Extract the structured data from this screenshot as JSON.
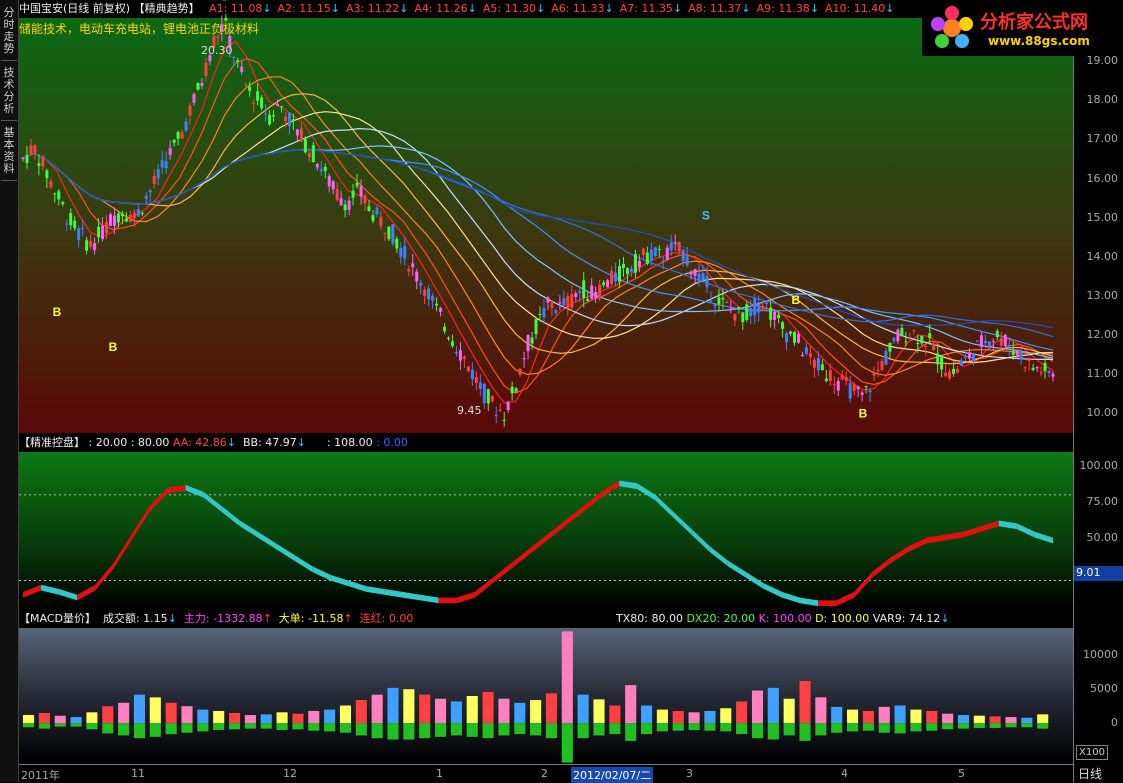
{
  "sidebar": {
    "tabs": [
      "分时走势",
      "技术分析",
      "基本资料"
    ]
  },
  "main": {
    "header": {
      "stock": "中国宝安(日线 前复权)",
      "indicator": "【精典趋势】",
      "subtitle": "储能技术，电动车充电站，锂电池正负极材料",
      "mas": [
        {
          "label": "A1: 11.08",
          "arrow": "↓"
        },
        {
          "label": "A2: 11.15",
          "arrow": "↓"
        },
        {
          "label": "A3: 11.22",
          "arrow": "↓"
        },
        {
          "label": "A4: 11.26",
          "arrow": "↓"
        },
        {
          "label": "A5: 11.30",
          "arrow": "↓"
        },
        {
          "label": "A6: 11.33",
          "arrow": "↓"
        },
        {
          "label": "A7: 11.35",
          "arrow": "↓"
        },
        {
          "label": "A8: 11.37",
          "arrow": "↓"
        },
        {
          "label": "A9: 11.38",
          "arrow": "↓"
        },
        {
          "label": "A10: 11.40",
          "arrow": "↓"
        }
      ]
    },
    "hi_label": "20.30",
    "lo_label": "9.45"
  },
  "ind": {
    "header": {
      "title": "【精准控盘】",
      "v1": ": 20.00",
      "v2": ": 80.00",
      "aa": "AA: 42.86",
      "aa_arrow": "↓",
      "bb": "BB: 47.97",
      "bb_arrow": "↓",
      "v3": ": 108.00",
      "v4": ": 0.00"
    },
    "side_value": "9.01"
  },
  "macd": {
    "header": {
      "title": "【MACD量价】",
      "cje": "成交额: 1.15",
      "cje_arrow": "↓",
      "zl": "主力: -1332.88",
      "zl_arrow": "↑",
      "dd": "大单: -11.58",
      "dd_arrow": "↑",
      "lh": "连红: 0.00",
      "tx": "TX80: 80.00",
      "dx": "DX20: 20.00",
      "k": "K: 100.00",
      "d": "D: 100.00",
      "var9": "VAR9: 74.12",
      "var9_arrow": "↓"
    },
    "unit": "X100"
  },
  "logo": {
    "text": "分析家公式网",
    "url": "www.88gs.com"
  },
  "xaxis": {
    "labels": [
      {
        "t": "2011年"
      },
      {
        "t": "11"
      },
      {
        "t": "12"
      },
      {
        "t": "1"
      },
      {
        "t": "2"
      },
      {
        "t": "2012/02/07/二",
        "hl": true
      },
      {
        "t": "3"
      },
      {
        "t": "4"
      },
      {
        "t": "5"
      }
    ],
    "period": "日线"
  },
  "chart_data": [
    {
      "type": "candlestick",
      "title": "中国宝安(日线 前复权)",
      "ylim": [
        9.5,
        20.1
      ],
      "yticks": [
        10.0,
        11.0,
        12.0,
        13.0,
        14.0,
        15.0,
        16.0,
        17.0,
        18.0,
        19.0
      ],
      "trend_close": [
        16.5,
        16.8,
        16.2,
        15.6,
        15.0,
        14.6,
        14.3,
        14.6,
        15.0,
        15.2,
        15.0,
        15.5,
        16.0,
        16.6,
        17.0,
        17.8,
        18.5,
        19.5,
        20.0,
        19.0,
        18.3,
        18.0,
        17.6,
        17.9,
        17.4,
        17.0,
        16.6,
        16.1,
        15.6,
        15.4,
        15.7,
        15.2,
        14.9,
        14.6,
        14.1,
        13.6,
        13.2,
        12.6,
        12.1,
        11.6,
        11.1,
        10.6,
        10.2,
        10.0,
        10.7,
        11.7,
        12.3,
        12.8,
        12.7,
        12.9,
        13.2,
        13.0,
        13.3,
        13.5,
        13.7,
        13.9,
        14.1,
        14.0,
        14.2,
        14.1,
        13.6,
        13.3,
        12.9,
        12.7,
        12.5,
        12.6,
        12.9,
        12.5,
        12.1,
        11.9,
        11.5,
        11.2,
        11.0,
        10.8,
        10.6,
        10.4,
        10.9,
        11.4,
        11.9,
        12.1,
        12.0,
        11.8,
        11.3,
        11.0,
        11.3,
        11.6,
        11.9,
        12.0,
        11.8,
        11.5,
        11.2,
        11.1,
        11.0
      ],
      "signals": [
        {
          "label": "B",
          "kind": "buy"
        },
        {
          "label": "B",
          "kind": "buy"
        },
        {
          "label": "S",
          "kind": "sell"
        },
        {
          "label": "S",
          "kind": "sell"
        },
        {
          "label": "B",
          "kind": "buy"
        },
        {
          "label": "B",
          "kind": "buy"
        },
        {
          "label": "B",
          "kind": "buy"
        }
      ]
    },
    {
      "type": "area",
      "title": "精准控盘",
      "ylim": [
        0,
        110
      ],
      "yticks": [
        25.0,
        50.0,
        75.0,
        100.0
      ],
      "ref_lines": [
        20,
        80
      ],
      "values": [
        10,
        15,
        12,
        8,
        15,
        30,
        50,
        70,
        83,
        85,
        80,
        70,
        60,
        52,
        44,
        36,
        28,
        22,
        18,
        14,
        12,
        10,
        8,
        6,
        6,
        10,
        20,
        30,
        40,
        50,
        60,
        70,
        80,
        88,
        86,
        78,
        66,
        54,
        42,
        32,
        24,
        16,
        10,
        6,
        4,
        4,
        10,
        24,
        34,
        42,
        48,
        50,
        52,
        56,
        60,
        58,
        52,
        48
      ]
    },
    {
      "type": "bar",
      "title": "MACD量价",
      "ylim": [
        -6000,
        14000
      ],
      "yticks": [
        0,
        5000,
        10000
      ],
      "up": [
        1200,
        1500,
        1100,
        900,
        1600,
        2500,
        3000,
        4200,
        3800,
        3000,
        2500,
        2000,
        1800,
        1500,
        1200,
        1300,
        1600,
        1400,
        1800,
        2000,
        2600,
        3400,
        4200,
        5200,
        5000,
        4200,
        3600,
        3200,
        4000,
        4600,
        3600,
        3000,
        3400,
        4400,
        13500,
        4200,
        3500,
        2600,
        5600,
        2600,
        2000,
        1800,
        1600,
        1800,
        2200,
        3200,
        4800,
        5200,
        3600,
        6200,
        3800,
        2400,
        2000,
        1800,
        2400,
        2600,
        2000,
        1800,
        1400,
        1200,
        1100,
        1000,
        900,
        800,
        1300
      ],
      "down": [
        -600,
        -800,
        -500,
        -500,
        -900,
        -1500,
        -1800,
        -2200,
        -2000,
        -1600,
        -1400,
        -1200,
        -1000,
        -900,
        -800,
        -800,
        -1000,
        -900,
        -1100,
        -1200,
        -1400,
        -1800,
        -2200,
        -2400,
        -2400,
        -2200,
        -2000,
        -1800,
        -2000,
        -2200,
        -1800,
        -1600,
        -1800,
        -2200,
        -5800,
        -2200,
        -1800,
        -1600,
        -2600,
        -1600,
        -1200,
        -1100,
        -1000,
        -1100,
        -1200,
        -1600,
        -2200,
        -2400,
        -1800,
        -2600,
        -1800,
        -1400,
        -1200,
        -1100,
        -1400,
        -1500,
        -1200,
        -1100,
        -900,
        -800,
        -700,
        -700,
        -600,
        -600,
        -800
      ]
    }
  ]
}
